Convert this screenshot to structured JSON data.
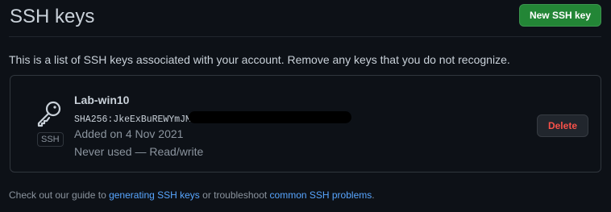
{
  "header": {
    "title": "SSH keys",
    "new_button_label": "New SSH key"
  },
  "description": "This is a list of SSH keys associated with your account. Remove any keys that you do not recognize.",
  "keys": [
    {
      "title": "Lab-win10",
      "fingerprint": "SHA256:JkeExBuREWYmJMt",
      "type_badge": "SSH",
      "added": "Added on 4 Nov 2021",
      "usage": "Never used — Read/write",
      "delete_label": "Delete",
      "icon": "key-icon"
    }
  ],
  "footer": {
    "text_before": "Check out our guide to ",
    "link1": "generating SSH keys",
    "text_middle": " or troubleshoot ",
    "link2": "common SSH problems",
    "text_after": "."
  },
  "colors": {
    "background": "#0d1117",
    "primary_button": "#238636",
    "danger_text": "#f85149",
    "link": "#58a6ff"
  }
}
